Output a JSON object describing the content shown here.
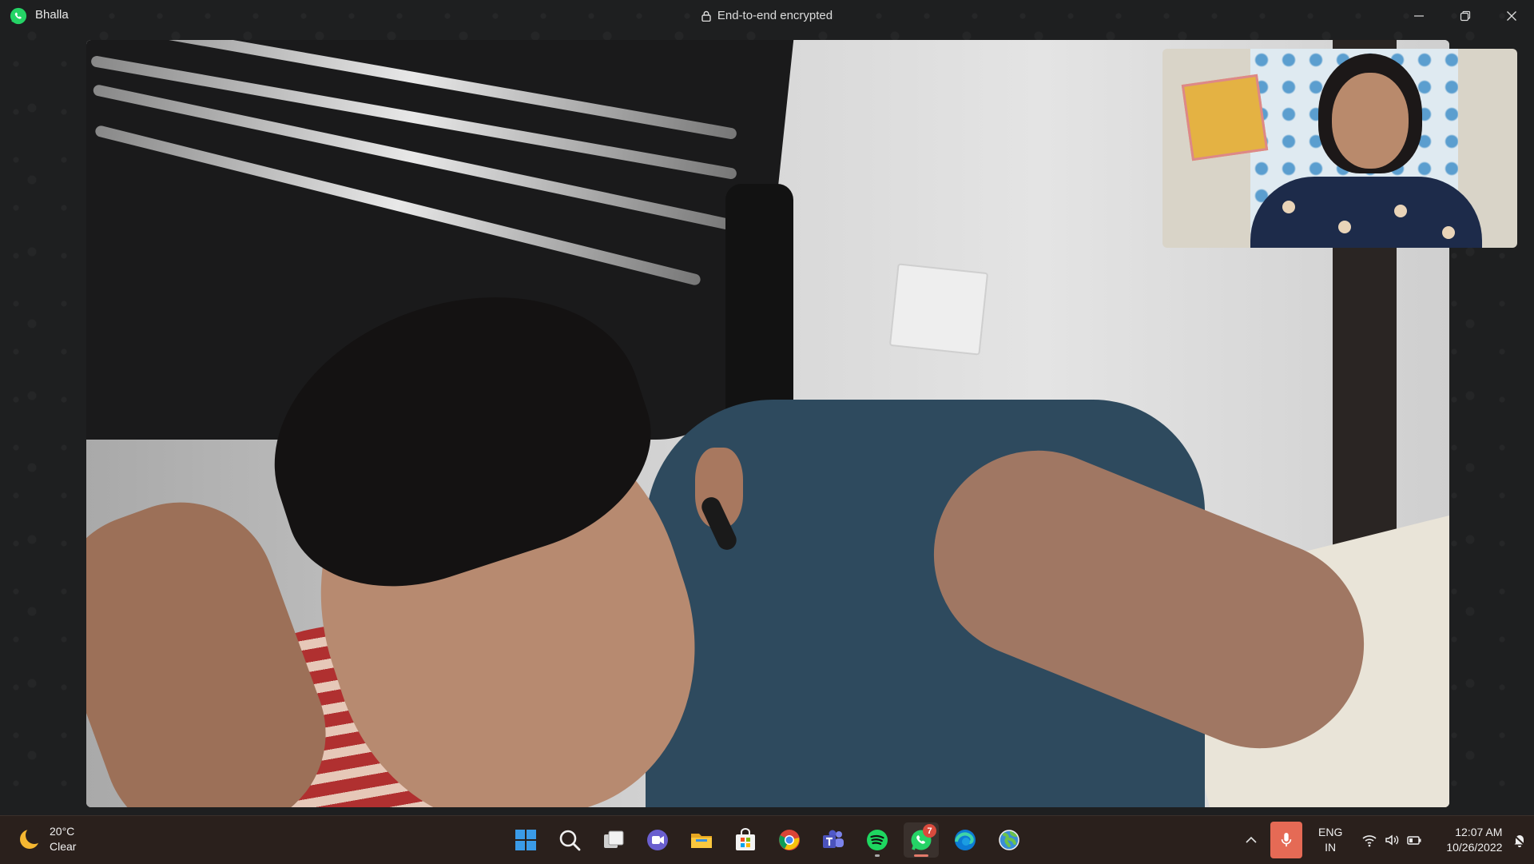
{
  "window": {
    "contact_name": "Bhalla",
    "encryption_text": "End-to-end encrypted"
  },
  "colors": {
    "whatsapp_green": "#25d366",
    "taskbar_bg": "#2a201c",
    "mic_active": "#e56a55",
    "badge": "#d94b3d"
  },
  "call": {
    "main_video": "remote-participant-video",
    "self_preview": "local-camera-preview"
  },
  "taskbar": {
    "weather": {
      "temp": "20°C",
      "condition": "Clear",
      "icon": "moon-icon"
    },
    "apps": [
      {
        "name": "start-icon"
      },
      {
        "name": "search-icon"
      },
      {
        "name": "task-view-icon"
      },
      {
        "name": "teams-chat-icon"
      },
      {
        "name": "file-explorer-icon"
      },
      {
        "name": "microsoft-store-icon"
      },
      {
        "name": "chrome-icon"
      },
      {
        "name": "teams-icon"
      },
      {
        "name": "spotify-icon"
      },
      {
        "name": "whatsapp-icon",
        "badge": "7",
        "active": true
      },
      {
        "name": "edge-icon"
      },
      {
        "name": "globe-app-icon"
      }
    ],
    "tray": {
      "language_line1": "ENG",
      "language_line2": "IN",
      "time": "12:07 AM",
      "date": "10/26/2022"
    }
  }
}
